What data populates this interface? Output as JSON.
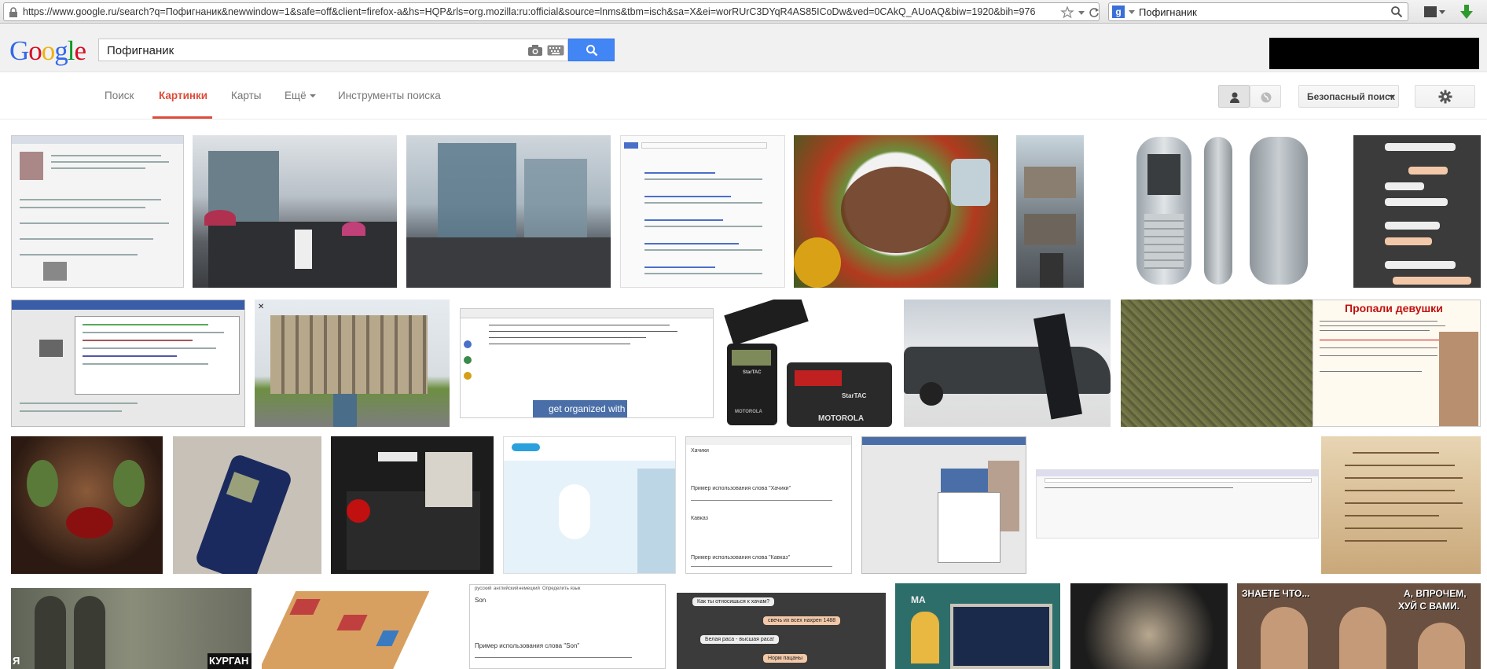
{
  "browser": {
    "url": "https://www.google.ru/search?q=Пофигнаник&newwindow=1&safe=off&client=firefox-a&hs=HQP&rls=org.mozilla:ru:official&source=lnms&tbm=isch&sa=X&ei=worRUrC3DYqR4AS85ICoDw&ved=0CAkQ_AUoAQ&biw=1920&bih=976",
    "search_box_value": "Пофигнаник"
  },
  "google": {
    "logo": [
      "G",
      "o",
      "o",
      "g",
      "l",
      "e"
    ],
    "logo_colors": [
      "#3369e8",
      "#d50f25",
      "#eeb211",
      "#3369e8",
      "#009925",
      "#d50f25"
    ],
    "query": "Пофигнаник"
  },
  "tabs": {
    "search": "Поиск",
    "images": "Картинки",
    "maps": "Карты",
    "more": "Ещё",
    "tools": "Инструменты поиска"
  },
  "controls": {
    "safe_search": "Безопасный поиск"
  },
  "thumb_captions": {
    "astrid_banner": "get organized with astrid",
    "motorola": "MOTOROLA",
    "startac": "StarTAC",
    "missing_title": "Пропали девушки",
    "kurgan": "КУРГАН",
    "ya": "Я",
    "znaete": "ЗНАЕТЕ ЧТО...",
    "a_vprochem": "А, ВПРОЧЕМ,",
    "vami": "ХУЙ С ВАМИ.",
    "ma": "MA"
  },
  "chat_bubbles": [
    "Как ты относишься к хачам?",
    "свечь их всех нахрен 1488",
    "Белая раса - высшая раса!",
    "Норм пацаны"
  ],
  "translator": {
    "word1": "Хачики",
    "example1": "Пример использования слова \"Хачики\"",
    "word2": "Кавказ",
    "example2": "Пример использования слова \"Кавказ\"",
    "word3": "Son",
    "example3": "Пример использования слова \"Son\"",
    "tabs": [
      "русский",
      "английский",
      "немецкий",
      "Определить язык"
    ]
  },
  "colors": {
    "accent": "#dd4b39",
    "search_button": "#4285f4"
  }
}
